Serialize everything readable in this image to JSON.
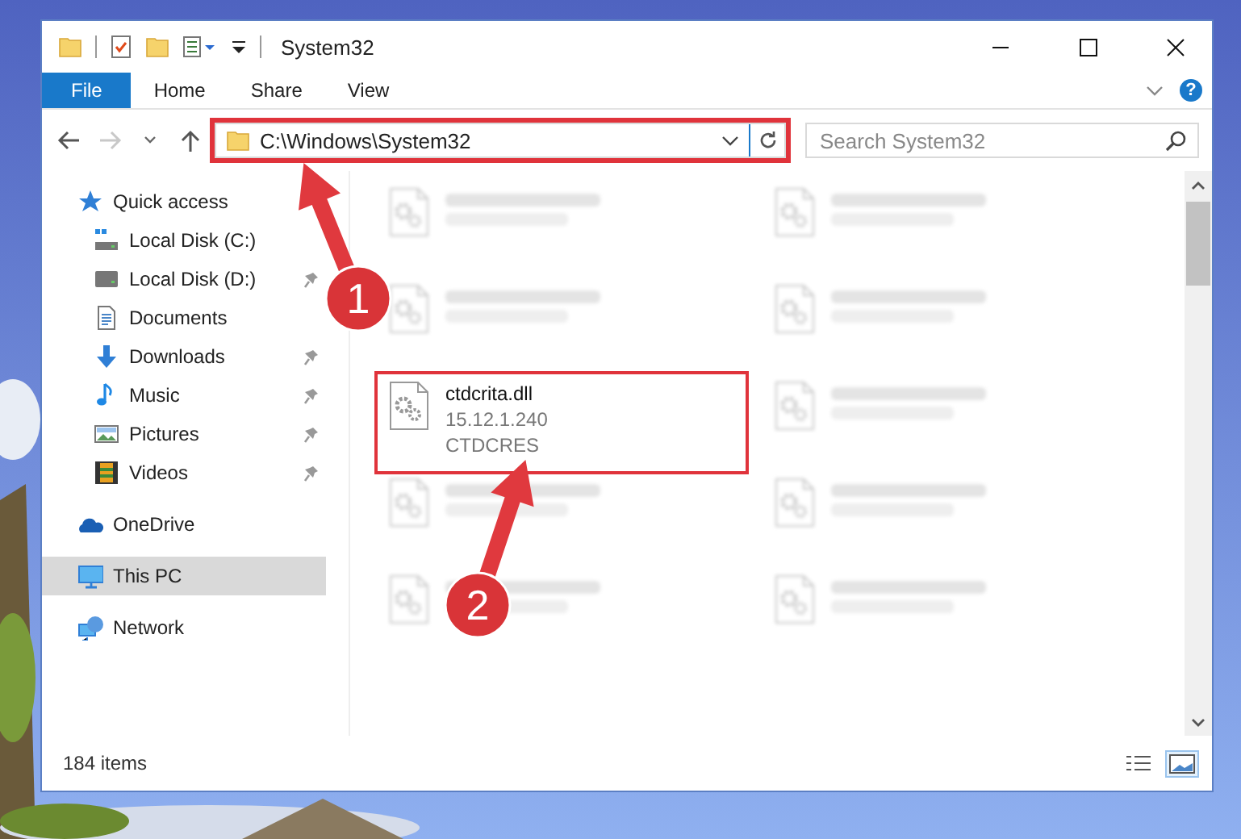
{
  "window": {
    "title": "System32"
  },
  "ribbon": {
    "tabs": [
      {
        "label": "File",
        "selected": true
      },
      {
        "label": "Home",
        "selected": false
      },
      {
        "label": "Share",
        "selected": false
      },
      {
        "label": "View",
        "selected": false
      }
    ],
    "help": "?"
  },
  "address": {
    "path": "C:\\Windows\\System32",
    "highlighted": true,
    "forward_disabled": true
  },
  "search": {
    "placeholder": "Search System32"
  },
  "sidebar": {
    "items": [
      {
        "label": "Quick access",
        "kind": "star",
        "selected": false,
        "children": [
          {
            "label": "Local Disk (C:)",
            "kind": "drive-c",
            "pinned": false,
            "selected": false
          },
          {
            "label": "Local Disk (D:)",
            "kind": "drive",
            "pinned": true,
            "selected": false
          },
          {
            "label": "Documents",
            "kind": "documents",
            "pinned": false,
            "selected": false
          },
          {
            "label": "Downloads",
            "kind": "downloads",
            "pinned": true,
            "selected": false
          },
          {
            "label": "Music",
            "kind": "music",
            "pinned": true,
            "selected": false
          },
          {
            "label": "Pictures",
            "kind": "pictures",
            "pinned": true,
            "selected": false
          },
          {
            "label": "Videos",
            "kind": "videos",
            "pinned": true,
            "selected": false
          }
        ]
      },
      {
        "label": "OneDrive",
        "kind": "cloud",
        "selected": false
      },
      {
        "label": "This PC",
        "kind": "pc",
        "selected": true
      },
      {
        "label": "Network",
        "kind": "network",
        "selected": false
      }
    ]
  },
  "files": [
    {
      "kind": "blurred"
    },
    {
      "kind": "blurred"
    },
    {
      "kind": "blurred"
    },
    {
      "kind": "blurred"
    },
    {
      "kind": "file",
      "name": "ctdcrita.dll",
      "details": [
        "15.12.1.240",
        "CTDCRES"
      ],
      "highlighted": true
    },
    {
      "kind": "blurred"
    },
    {
      "kind": "blurred"
    },
    {
      "kind": "blurred"
    },
    {
      "kind": "blurred"
    },
    {
      "kind": "blurred"
    }
  ],
  "status_bar": {
    "count": "184 items",
    "views": [
      {
        "kind": "details",
        "selected": false
      },
      {
        "kind": "large-icons",
        "selected": true
      }
    ]
  },
  "callouts": [
    {
      "label": "1"
    },
    {
      "label": "2"
    }
  ]
}
